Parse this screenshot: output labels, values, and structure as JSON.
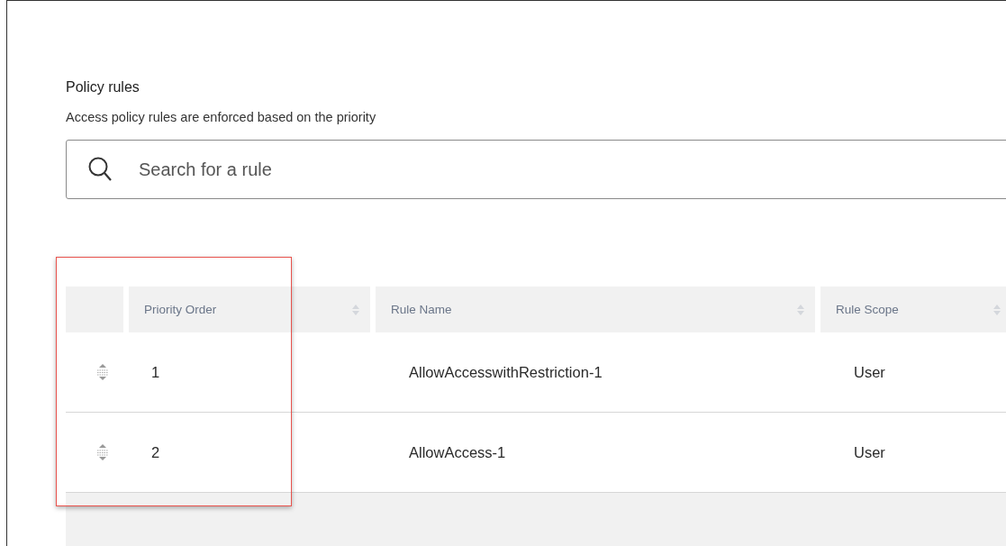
{
  "section": {
    "title": "Policy rules",
    "subtitle": "Access policy rules are enforced based on the priority"
  },
  "search": {
    "placeholder": "Search for a rule"
  },
  "table": {
    "columns": [
      "Priority Order",
      "Rule Name",
      "Rule Scope"
    ],
    "rows": [
      {
        "priority": "1",
        "name": "AllowAccesswithRestriction-1",
        "scope": "User"
      },
      {
        "priority": "2",
        "name": "AllowAccess-1",
        "scope": "User"
      }
    ]
  },
  "highlight": {
    "shown": true
  }
}
